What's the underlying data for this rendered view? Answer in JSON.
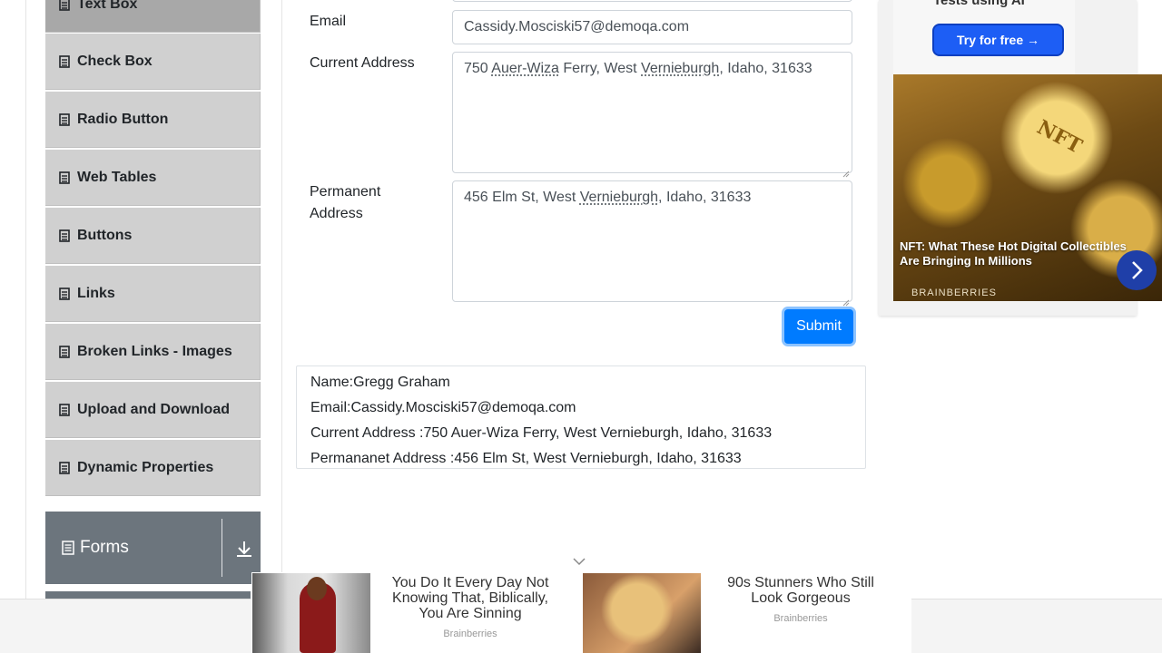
{
  "sidebar": {
    "items": [
      {
        "label": "Text Box",
        "active": true
      },
      {
        "label": "Check Box"
      },
      {
        "label": "Radio Button"
      },
      {
        "label": "Web Tables"
      },
      {
        "label": "Buttons"
      },
      {
        "label": "Links"
      },
      {
        "label": "Broken Links - Images"
      },
      {
        "label": "Upload and Download"
      },
      {
        "label": "Dynamic Properties"
      }
    ],
    "group": {
      "label": "Forms",
      "icon": "document-icon",
      "toggle_icon": "download-arrow-icon"
    },
    "colors": {
      "item_bg": "#d0d0d0",
      "active_bg": "#a8a8a8",
      "group_bg": "#6c757d"
    }
  },
  "form": {
    "email": {
      "label": "Email",
      "value": "Cassidy.Mosciski57@demoqa.com"
    },
    "current_address": {
      "label": "Current Address",
      "value": "750 Auer-Wiza Ferry, West Vernieburgh, Idaho, 31633",
      "parts": {
        "a": "750 ",
        "b": "Auer-Wiza",
        "c": " Ferry, West ",
        "d": "Vernieburgh",
        "e": ", Idaho, 31633"
      }
    },
    "permanent_address": {
      "label_line1": "Permanent",
      "label_line2": "Address",
      "value": "456 Elm St, West Vernieburgh, Idaho, 31633",
      "parts": {
        "a": "456 Elm St, West ",
        "b": "Vernieburgh",
        "c": ", Idaho, 31633"
      }
    },
    "submit_label": "Submit",
    "submit_color": "#007bff"
  },
  "output": {
    "name": "Name:Gregg Graham",
    "email": "Email:Cassidy.Mosciski57@demoqa.com",
    "current_address": "Current Address :750 Auer-Wiza Ferry, West Vernieburgh, Idaho, 31633",
    "permanent_address": "Permananet Address :456 Elm St, West Vernieburgh, Idaho, 31633"
  },
  "ads": {
    "side": {
      "top_text": "Tests using AI",
      "try_button": "Try for free →",
      "coin_text": "NFT",
      "title": "NFT: What These Hot Digital Collectibles Are Bringing In Millions",
      "source": "BRAINBERRIES"
    },
    "bottom": [
      {
        "title": "You Do It Every Day Not Knowing That, Biblically, You Are Sinning",
        "source": "Brainberries"
      },
      {
        "title": "90s Stunners Who Still Look Gorgeous",
        "source": "Brainberries"
      }
    ]
  }
}
